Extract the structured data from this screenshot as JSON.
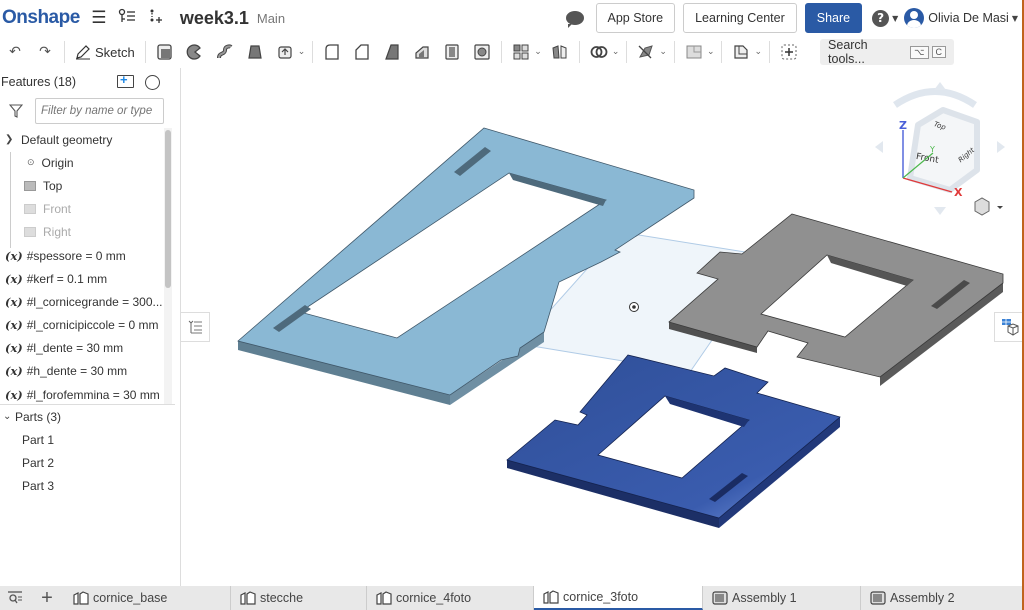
{
  "header": {
    "logo": "Onshape",
    "menu_icon": "hamburger-icon",
    "doc_title": "week3.1",
    "branch": "Main",
    "buttons": {
      "app_store": "App Store",
      "learning_center": "Learning Center",
      "share": "Share"
    },
    "help_glyph": "?",
    "user_name": "Olivia De Masi"
  },
  "toolbar": {
    "sketch_label": "Sketch",
    "search_placeholder": "Search tools...",
    "shortcut_keys": [
      "⌥",
      "C"
    ]
  },
  "feature_panel": {
    "title": "Features (18)",
    "filter_placeholder": "Filter by name or type",
    "default_geometry": {
      "label": "Default geometry",
      "items": [
        {
          "label": "Origin",
          "type": "origin"
        },
        {
          "label": "Top",
          "type": "plane",
          "visible": true
        },
        {
          "label": "Front",
          "type": "plane",
          "visible": false
        },
        {
          "label": "Right",
          "type": "plane",
          "visible": false
        }
      ]
    },
    "variables": [
      "#spessore = 0 mm",
      "#kerf = 0.1 mm",
      "#l_cornicegrande = 300...",
      "#l_cornicipiccole = 0 mm",
      "#l_dente = 30 mm",
      "#h_dente = 30 mm",
      "#l_forofemmina = 30 mm"
    ],
    "variable_icon": "(x)",
    "parts": {
      "label": "Parts (3)",
      "items": [
        "Part 1",
        "Part 2",
        "Part 3"
      ]
    }
  },
  "view_cube": {
    "faces": {
      "top": "Top",
      "front": "Front",
      "right": "Right"
    },
    "axes": {
      "x": "X",
      "y": "Y",
      "z": "Z"
    }
  },
  "viewport": {
    "parts": [
      {
        "name": "Part 1",
        "color": "#8ab8d4"
      },
      {
        "name": "Part 2",
        "color": "#8f8f8f"
      },
      {
        "name": "Part 3",
        "color": "#33539e"
      }
    ]
  },
  "tabs": [
    {
      "label": "cornice_base",
      "type": "part-studio",
      "active": false
    },
    {
      "label": "stecche",
      "type": "part-studio",
      "active": false
    },
    {
      "label": "cornice_4foto",
      "type": "part-studio",
      "active": false
    },
    {
      "label": "cornice_3foto",
      "type": "part-studio",
      "active": true
    },
    {
      "label": "Assembly 1",
      "type": "assembly",
      "active": false
    },
    {
      "label": "Assembly 2",
      "type": "assembly",
      "active": false
    }
  ]
}
